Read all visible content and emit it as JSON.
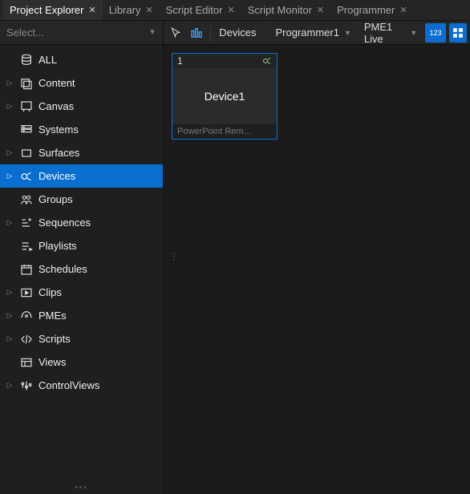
{
  "tabs": [
    {
      "label": "Project Explorer",
      "active": true
    },
    {
      "label": "Library",
      "active": false
    },
    {
      "label": "Script Editor",
      "active": false
    },
    {
      "label": "Script Monitor",
      "active": false
    },
    {
      "label": "Programmer",
      "active": false
    }
  ],
  "sidebar": {
    "select_placeholder": "Select...",
    "items": [
      {
        "label": "ALL",
        "expandable": false,
        "icon": "db-icon"
      },
      {
        "label": "Content",
        "expandable": true,
        "icon": "content-icon"
      },
      {
        "label": "Canvas",
        "expandable": true,
        "icon": "canvas-icon"
      },
      {
        "label": "Systems",
        "expandable": false,
        "icon": "systems-icon"
      },
      {
        "label": "Surfaces",
        "expandable": true,
        "icon": "surfaces-icon"
      },
      {
        "label": "Devices",
        "expandable": true,
        "icon": "devices-icon",
        "selected": true
      },
      {
        "label": "Groups",
        "expandable": false,
        "icon": "groups-icon"
      },
      {
        "label": "Sequences",
        "expandable": true,
        "icon": "sequences-icon"
      },
      {
        "label": "Playlists",
        "expandable": false,
        "icon": "playlists-icon"
      },
      {
        "label": "Schedules",
        "expandable": false,
        "icon": "schedules-icon"
      },
      {
        "label": "Clips",
        "expandable": true,
        "icon": "clips-icon"
      },
      {
        "label": "PMEs",
        "expandable": true,
        "icon": "pmes-icon"
      },
      {
        "label": "Scripts",
        "expandable": true,
        "icon": "scripts-icon"
      },
      {
        "label": "Views",
        "expandable": false,
        "icon": "views-icon"
      },
      {
        "label": "ControlViews",
        "expandable": true,
        "icon": "controlviews-icon"
      }
    ]
  },
  "toolbar": {
    "breadcrumb": "Devices",
    "programmer": "Programmer1",
    "pme": "PME1 Live",
    "numbers_label": "123"
  },
  "tiles": [
    {
      "index": "1",
      "title": "Device1",
      "subtitle": "PowerPoint Rem..."
    }
  ]
}
